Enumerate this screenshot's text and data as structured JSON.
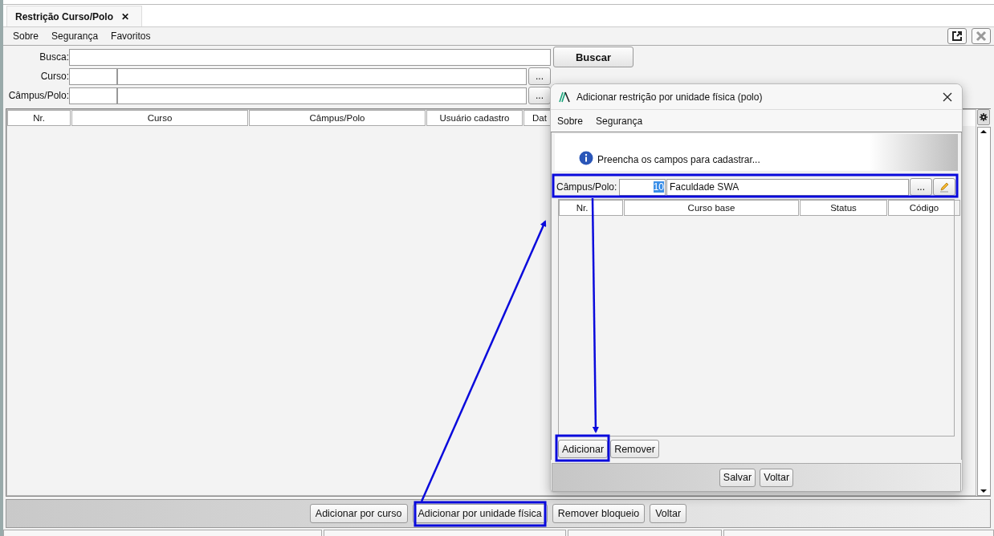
{
  "tab": {
    "title": "Restrição Curso/Polo",
    "close": "✕"
  },
  "menu": [
    {
      "label": "Sobre"
    },
    {
      "label": "Segurança"
    },
    {
      "label": "Favoritos"
    }
  ],
  "form": {
    "busca_label": "Busca:",
    "buscar_button": "Buscar",
    "curso_label": "Curso:",
    "curso_browse": "...",
    "campus_label": "Câmpus/Polo:",
    "campus_browse": "..."
  },
  "table": {
    "columns": [
      "Nr.",
      "Curso",
      "Câmpus/Polo",
      "Usuário cadastro",
      "Dat"
    ]
  },
  "buttons": [
    "Adicionar por curso",
    "Adicionar por unidade física",
    "Remover bloqueio",
    "Voltar"
  ],
  "dialog": {
    "title": "Adicionar restrição por unidade física (polo)",
    "menu": [
      {
        "label": "Sobre"
      },
      {
        "label": "Segurança"
      }
    ],
    "info": "Preencha os campos para cadastrar...",
    "campus": {
      "label": "Câmpus/Polo:",
      "code": "10",
      "code_selected": true,
      "name": "Faculdade SWA",
      "browse": "..."
    },
    "columns": [
      "Nr.",
      "Curso base",
      "Status",
      "Código"
    ],
    "list_buttons": [
      "Adicionar",
      "Remover"
    ],
    "footer_buttons": [
      "Salvar",
      "Voltar"
    ]
  }
}
